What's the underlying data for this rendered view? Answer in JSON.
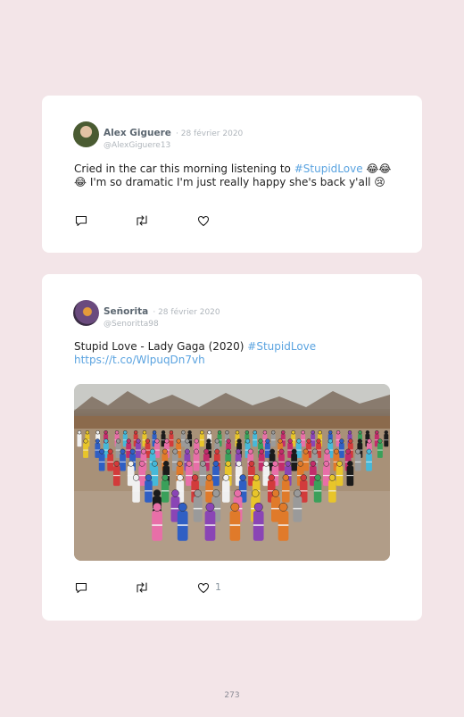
{
  "tweets": [
    {
      "name": "Alex Giguere",
      "date": "· 28 février 2020",
      "handle": "@AlexGiguere13",
      "text_before": "Cried in the car this morning listening to ",
      "hashtag": "#StupidLove",
      "text_after": " 😂😂 😂 I'm so dramatic I'm just really happy she's back y'all 😢",
      "likes": ""
    },
    {
      "name": "Señorita",
      "date": "· 28 février 2020",
      "handle": "@Senoritta98",
      "text_before": "Stupid Love - Lady Gaga (2020) ",
      "hashtag": "#StupidLove",
      "link": "https://t.co/WlpuqDn7vh",
      "likes": "1"
    }
  ],
  "icons": [
    "reply-icon",
    "retweet-icon",
    "heart-icon"
  ],
  "colors": {
    "background": "#f3e5e8",
    "card": "#ffffff",
    "link": "#5aa3e0",
    "name": "#5b6670",
    "meta": "#b0b6bc"
  },
  "page_number": "273"
}
